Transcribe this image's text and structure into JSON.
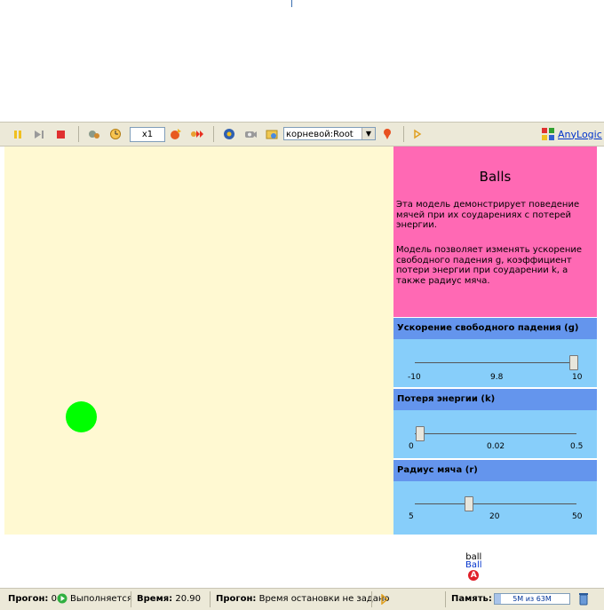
{
  "toolbar": {
    "speed": "x1",
    "experiment_select": "корневой:Root",
    "brand": "AnyLogic"
  },
  "info": {
    "title": "Balls",
    "para1": "Эта модель демонстрирует поведение мячей при их соударениях с потерей энергии.",
    "para2": "Модель позволяет изменять ускорение свободного падения g, коэффициент потери энергии при соударении k, а также радиус мяча."
  },
  "sliders": [
    {
      "label": "Ускорение свободного падения  (g)",
      "min": "-10",
      "value": "9.8",
      "max": "10",
      "fraction": 1.0
    },
    {
      "label": "Потеря энергии  (k)",
      "min": "0",
      "value": "0.02",
      "max": "0.5",
      "fraction": 0.04
    },
    {
      "label": "Радиус мяча  (r)",
      "min": "5",
      "value": "20",
      "max": "50",
      "fraction": 0.333
    }
  ],
  "agent": {
    "name": "ball",
    "type": "Ball",
    "badge": "A"
  },
  "status": {
    "runs_label": "Прогон:",
    "runs_value": "0",
    "state": "Выполняется",
    "time_label": "Время:",
    "time_value": "20.90",
    "stop_label": "Прогон:",
    "stop_value": "Время остановки не задано",
    "memory_label": "Память:",
    "memory_value": "5M из 63M",
    "memory_fraction": 0.08
  },
  "colors": {
    "canvas": "#fff9d2",
    "ball": "#00ff00",
    "info_bg": "#ff69b4",
    "section_header": "#6495ed",
    "section_body": "#87cefa"
  }
}
